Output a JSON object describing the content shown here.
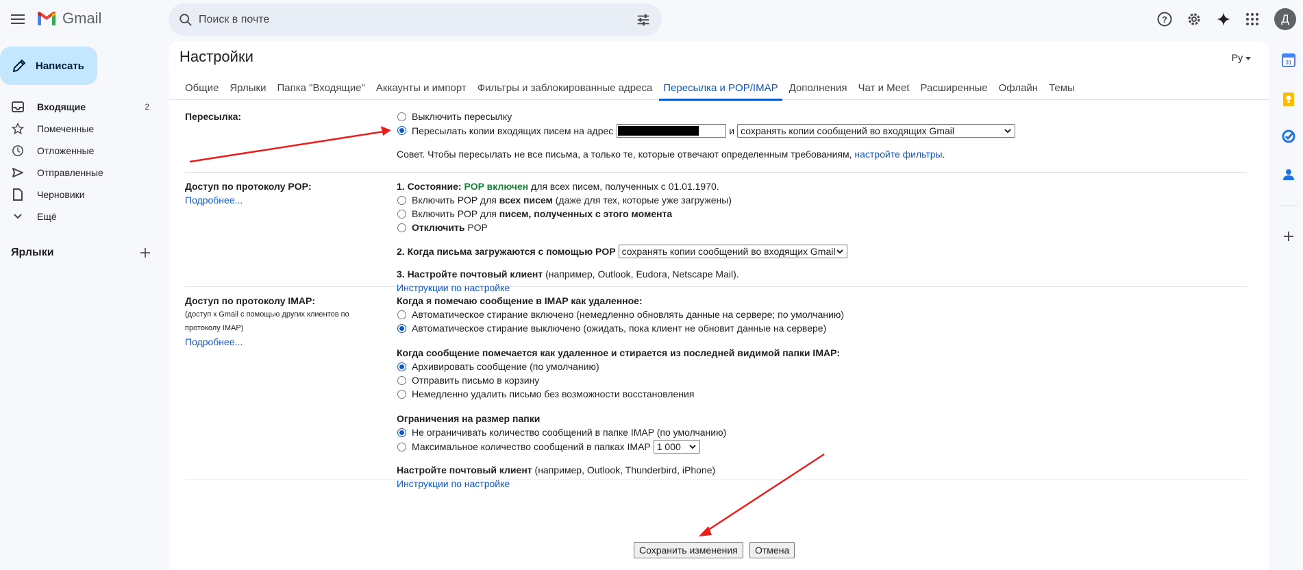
{
  "app": {
    "name": "Gmail",
    "avatar_letter": "Д"
  },
  "search": {
    "placeholder": "Поиск в почте"
  },
  "sidebar": {
    "compose_label": "Написать",
    "items": [
      {
        "label": "Входящие",
        "count": "2",
        "icon": "inbox-icon"
      },
      {
        "label": "Помеченные",
        "count": "",
        "icon": "star-icon"
      },
      {
        "label": "Отложенные",
        "count": "",
        "icon": "clock-icon"
      },
      {
        "label": "Отправленные",
        "count": "",
        "icon": "send-icon"
      },
      {
        "label": "Черновики",
        "count": "",
        "icon": "draft-icon"
      },
      {
        "label": "Ещё",
        "count": "",
        "icon": "chevron-down-icon"
      }
    ],
    "labels_title": "Ярлыки"
  },
  "settings": {
    "title": "Настройки",
    "lang": "Ру",
    "tabs": [
      {
        "label": "Общие"
      },
      {
        "label": "Ярлыки"
      },
      {
        "label": "Папка \"Входящие\""
      },
      {
        "label": "Аккаунты и импорт"
      },
      {
        "label": "Фильтры и заблокированные адреса"
      },
      {
        "label": "Пересылка и POP/IMAP",
        "active": true
      },
      {
        "label": "Дополнения"
      },
      {
        "label": "Чат и Meet"
      },
      {
        "label": "Расширенные"
      },
      {
        "label": "Офлайн"
      },
      {
        "label": "Темы"
      }
    ],
    "forwarding": {
      "label": "Пересылка:",
      "opt_off": "Выключить пересылку",
      "opt_on": "Пересылать копии входящих писем на адрес",
      "and": "и",
      "keep_select": "сохранять копии сообщений во входящих Gmail",
      "tip": "Совет. Чтобы пересылать не все письма, а только те, которые отвечают определенным требованиям,",
      "tip_link": "настройте фильтры",
      "tip_end": "."
    },
    "pop": {
      "label": "Доступ по протоколу POP:",
      "more": "Подробнее...",
      "status_prefix": "1. Состояние:",
      "status_value": "POP включен",
      "status_rest": "для всех писем, полученных с 01.01.1970.",
      "opt_all_pre": "Включить POP для",
      "opt_all_bold": "всех писем",
      "opt_all_post": "(даже для тех, которые уже загружены)",
      "opt_now_pre": "Включить POP для",
      "opt_now_bold": "писем, полученных с этого момента",
      "opt_off_bold": "Отключить",
      "opt_off_post": "POP",
      "when_label": "2. Когда письма загружаются с помощью POP",
      "when_select": "сохранять копии сообщений во входящих Gmail",
      "client_bold": "3. Настройте почтовый клиент",
      "client_rest": "(например, Outlook, Eudora, Netscape Mail).",
      "client_link": "Инструкции по настройке"
    },
    "imap": {
      "label": "Доступ по протоколу IMAP:",
      "sub1": "(доступ к Gmail с помощью других клиентов по",
      "sub2": "протоколу IMAP)",
      "more": "Подробнее...",
      "deleted_title": "Когда я помечаю сообщение в IMAP как удаленное:",
      "auto_on": "Автоматическое стирание включено (немедленно обновлять данные на сервере; по умолчанию)",
      "auto_off": "Автоматическое стирание выключено (ожидать, пока клиент не обновит данные на сервере)",
      "expunge_title": "Когда сообщение помечается как удаленное и стирается из последней видимой папки IMAP:",
      "archive": "Архивировать сообщение (по умолчанию)",
      "trash": "Отправить письмо в корзину",
      "delete": "Немедленно удалить письмо без возможности восстановления",
      "limit_title": "Ограничения на размер папки",
      "no_limit": "Не ограничивать количество сообщений в папке IMAP (по умолчанию)",
      "max_limit": "Максимальное количество сообщений в папках IMAP",
      "max_select": "1 000",
      "client_bold": "Настройте почтовый клиент",
      "client_rest": "(например, Outlook, Thunderbird, iPhone)",
      "client_link": "Инструкции по настройке"
    },
    "save_button": "Сохранить изменения",
    "cancel_button": "Отмена"
  },
  "colors": {
    "accent": "#0b57d0",
    "annotation": "#e8201c",
    "pop_on": "#188038"
  }
}
